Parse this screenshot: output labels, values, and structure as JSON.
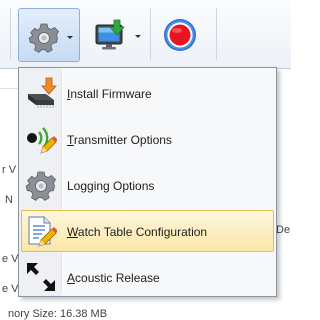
{
  "toolbar": {
    "buttons": [
      {
        "icon": "gear-icon",
        "has_dropdown": true,
        "state": "pressed"
      },
      {
        "icon": "monitor-download-icon",
        "has_dropdown": true
      },
      {
        "icon": "record-icon"
      }
    ]
  },
  "menu": {
    "items": [
      {
        "icon": "firmware-chip-icon",
        "accel": "I",
        "rest": "nstall Firmware"
      },
      {
        "icon": "transmitter-edit-icon",
        "accel": "T",
        "rest": "ransmitter Options"
      },
      {
        "icon": "gear-icon",
        "accel": "",
        "rest": "Logging Options"
      },
      {
        "icon": "document-edit-icon",
        "accel": "W",
        "rest": "atch Table Configuration",
        "highlighted": true
      },
      {
        "icon": "arrows-icon",
        "accel": "A",
        "rest": "coustic Release"
      }
    ]
  },
  "background_text": {
    "line1": "r V",
    "line2": "N",
    "line3": "e V",
    "line4": "e V",
    "line5": "nory Size: 16.38 MB",
    "line6": "De"
  },
  "colors": {
    "accent": "#3399ff",
    "record": "#e8141e",
    "menu_hover_border": "#e2bd4f",
    "menu_hover_fill": "#fbe7a8"
  }
}
